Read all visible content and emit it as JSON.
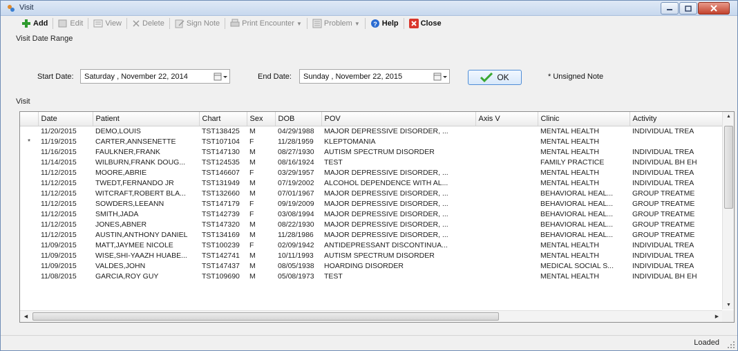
{
  "window": {
    "title": "Visit"
  },
  "toolbar": [
    {
      "label": "Add",
      "icon": "add-icon",
      "enabled": true
    },
    {
      "label": "Edit",
      "icon": "edit-icon",
      "enabled": false
    },
    {
      "label": "View",
      "icon": "view-icon",
      "enabled": false
    },
    {
      "label": "Delete",
      "icon": "delete-icon",
      "enabled": false
    },
    {
      "label": "Sign Note",
      "icon": "sign-note-icon",
      "enabled": false
    },
    {
      "label": "Print Encounter",
      "icon": "print-icon",
      "enabled": false
    },
    {
      "label": "Problem",
      "icon": "problem-icon",
      "enabled": false
    },
    {
      "label": "Help",
      "icon": "help-icon",
      "enabled": true
    },
    {
      "label": "Close",
      "icon": "close-icon",
      "enabled": true
    }
  ],
  "date_range": {
    "label": "Visit Date Range",
    "start_label": "Start Date:",
    "start_value": "Saturday   , November 22, 2014",
    "end_label": "End Date:",
    "end_value": "Sunday   , November 22, 2015",
    "ok_label": "OK",
    "note": "* Unsigned Note"
  },
  "grid": {
    "label": "Visit",
    "columns": [
      "Date",
      "Patient",
      "Chart",
      "Sex",
      "DOB",
      "POV",
      "Axis V",
      "Clinic",
      "Activity"
    ],
    "rows": [
      {
        "marker": "",
        "cells": [
          "11/20/2015",
          "DEMO,LOUIS",
          "TST138425",
          "M",
          "04/29/1988",
          "MAJOR DEPRESSIVE DISORDER, ...",
          "",
          "MENTAL HEALTH",
          "INDIVIDUAL TREA"
        ]
      },
      {
        "marker": "*",
        "cells": [
          "11/19/2015",
          "CARTER,ANNSENETTE",
          "TST107104",
          "F",
          "11/28/1959",
          "KLEPTOMANIA",
          "",
          "MENTAL HEALTH",
          ""
        ]
      },
      {
        "marker": "",
        "cells": [
          "11/16/2015",
          "FAULKNER,FRANK",
          "TST147130",
          "M",
          "08/27/1930",
          "AUTISM SPECTRUM DISORDER",
          "",
          "MENTAL HEALTH",
          "INDIVIDUAL TREA"
        ]
      },
      {
        "marker": "",
        "cells": [
          "11/14/2015",
          "WILBURN,FRANK DOUG...",
          "TST124535",
          "M",
          "08/16/1924",
          "TEST",
          "",
          "FAMILY PRACTICE",
          "INDIVIDUAL BH EH"
        ]
      },
      {
        "marker": "",
        "cells": [
          "11/12/2015",
          "MOORE,ABRIE",
          "TST146607",
          "F",
          "03/29/1957",
          "MAJOR DEPRESSIVE DISORDER, ...",
          "",
          "MENTAL HEALTH",
          "INDIVIDUAL TREA"
        ]
      },
      {
        "marker": "",
        "cells": [
          "11/12/2015",
          "TWEDT,FERNANDO JR",
          "TST131949",
          "M",
          "07/19/2002",
          "ALCOHOL DEPENDENCE WITH AL...",
          "",
          "MENTAL HEALTH",
          "INDIVIDUAL TREA"
        ]
      },
      {
        "marker": "",
        "cells": [
          "11/12/2015",
          "WITCRAFT,ROBERT BLA...",
          "TST132660",
          "M",
          "07/01/1967",
          "MAJOR DEPRESSIVE DISORDER, ...",
          "",
          "BEHAVIORAL HEAL...",
          "GROUP TREATME"
        ]
      },
      {
        "marker": "",
        "cells": [
          "11/12/2015",
          "SOWDERS,LEEANN",
          "TST147179",
          "F",
          "09/19/2009",
          "MAJOR DEPRESSIVE DISORDER, ...",
          "",
          "BEHAVIORAL HEAL...",
          "GROUP TREATME"
        ]
      },
      {
        "marker": "",
        "cells": [
          "11/12/2015",
          "SMITH,JADA",
          "TST142739",
          "F",
          "03/08/1994",
          "MAJOR DEPRESSIVE DISORDER, ...",
          "",
          "BEHAVIORAL HEAL...",
          "GROUP TREATME"
        ]
      },
      {
        "marker": "",
        "cells": [
          "11/12/2015",
          "JONES,ABNER",
          "TST147320",
          "M",
          "08/22/1930",
          "MAJOR DEPRESSIVE DISORDER, ...",
          "",
          "BEHAVIORAL HEAL...",
          "GROUP TREATME"
        ]
      },
      {
        "marker": "",
        "cells": [
          "11/12/2015",
          "AUSTIN,ANTHONY DANIEL",
          "TST134169",
          "M",
          "11/28/1986",
          "MAJOR DEPRESSIVE DISORDER, ...",
          "",
          "BEHAVIORAL HEAL...",
          "GROUP TREATME"
        ]
      },
      {
        "marker": "",
        "cells": [
          "11/09/2015",
          "MATT,JAYMEE NICOLE",
          "TST100239",
          "F",
          "02/09/1942",
          "ANTIDEPRESSANT DISCONTINUA...",
          "",
          "MENTAL HEALTH",
          "INDIVIDUAL TREA"
        ]
      },
      {
        "marker": "",
        "cells": [
          "11/09/2015",
          "WISE,SHI-YAAZH HUABE...",
          "TST142741",
          "M",
          "10/11/1993",
          "AUTISM SPECTRUM DISORDER",
          "",
          "MENTAL HEALTH",
          "INDIVIDUAL TREA"
        ]
      },
      {
        "marker": "",
        "cells": [
          "11/09/2015",
          "VALDES,JOHN",
          "TST147437",
          "M",
          "08/05/1938",
          "HOARDING DISORDER",
          "",
          "MEDICAL SOCIAL S...",
          "INDIVIDUAL TREA"
        ]
      },
      {
        "marker": "",
        "cells": [
          "11/08/2015",
          "GARCIA,ROY GUY",
          "TST109690",
          "M",
          "05/08/1973",
          "TEST",
          "",
          "MENTAL HEALTH",
          "INDIVIDUAL BH EH"
        ]
      }
    ]
  },
  "status": {
    "text": "Loaded"
  },
  "colors": {
    "add_green": "#2e9a2e",
    "close_red": "#d9362b",
    "help_blue": "#2a6bd1",
    "ok_check": "#3aa832"
  }
}
